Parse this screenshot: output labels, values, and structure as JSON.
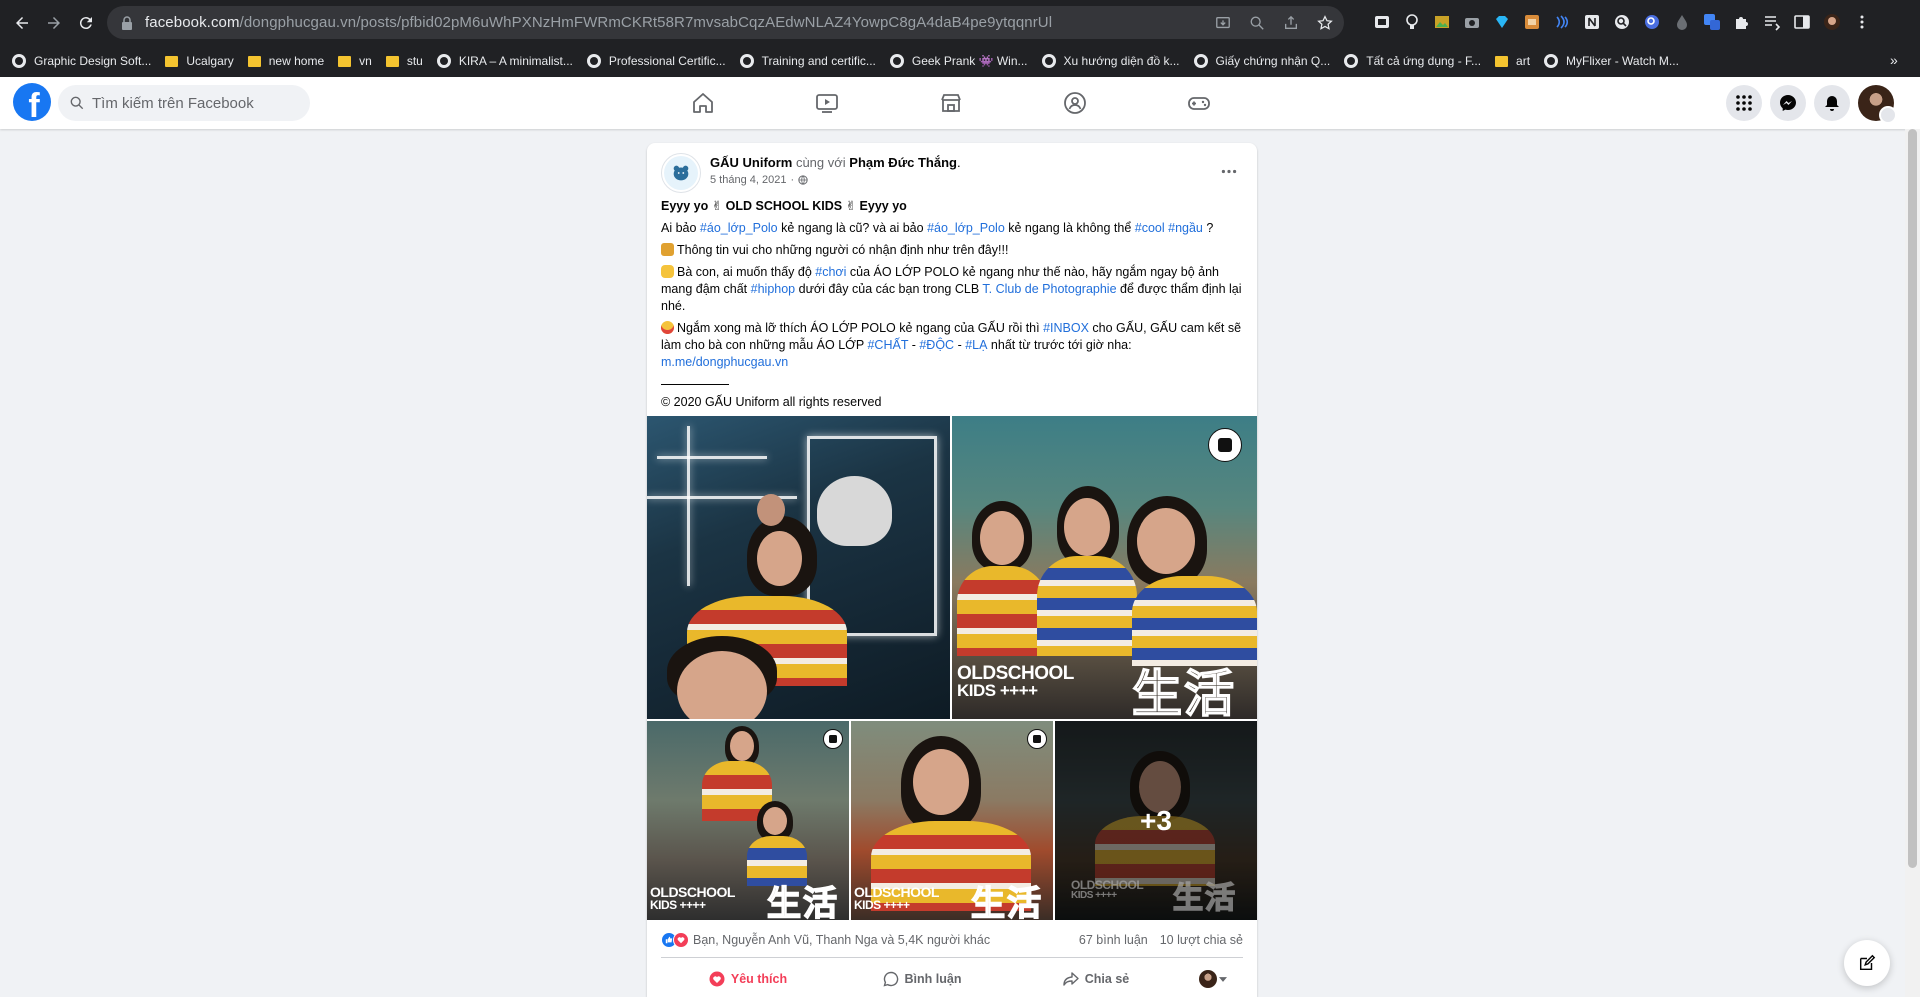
{
  "browser": {
    "url_host": "facebook.com",
    "url_path": "/dongphucgau.vn/posts/pfbid02pM6uWhPXNzHmFWRmCKRt58R7mvsabCqzAEdwNLAZ4YowpC8gA4daB4pe9ytqqnrUl",
    "bookmarks": [
      {
        "label": "Graphic Design Soft...",
        "type": "site"
      },
      {
        "label": "Ucalgary",
        "type": "folder"
      },
      {
        "label": "new home",
        "type": "folder"
      },
      {
        "label": "vn",
        "type": "folder"
      },
      {
        "label": "stu",
        "type": "folder"
      },
      {
        "label": "KIRA – A minimalist...",
        "type": "site"
      },
      {
        "label": "Professional Certific...",
        "type": "site"
      },
      {
        "label": "Training and certific...",
        "type": "site"
      },
      {
        "label": "Geek Prank 👾 Win...",
        "type": "site"
      },
      {
        "label": "Xu hướng diện đồ k...",
        "type": "site"
      },
      {
        "label": "Giấy chứng nhận Q...",
        "type": "site"
      },
      {
        "label": "Tất cả ứng dụng - F...",
        "type": "site"
      },
      {
        "label": "art",
        "type": "folder"
      },
      {
        "label": "MyFlixer - Watch M...",
        "type": "site"
      }
    ],
    "more_bookmarks": "»"
  },
  "facebook": {
    "logo_letter": "f",
    "search_placeholder": "Tìm kiếm trên Facebook",
    "nav_icons": [
      "home-icon",
      "watch-icon",
      "marketplace-icon",
      "groups-icon",
      "gaming-icon"
    ]
  },
  "post": {
    "author": "GẤU Uniform",
    "with_text": " cùng với ",
    "tagged": "Phạm Đức Thắng",
    "tagged_suffix": ".",
    "date": "5 tháng 4, 2021",
    "date_sep": "·",
    "title_line": "Eyyy yo ✌ OLD SCHOOL KIDS ✌ Eyyy yo",
    "p1_a": "Ai bảo ",
    "p1_tag1": "#áo_lớp_Polo",
    "p1_b": " kẻ ngang là cũ? và ai bảo ",
    "p1_tag2": "#áo_lớp_Polo",
    "p1_c": " kẻ ngang là không thể ",
    "p1_tag3": "#cool",
    "p1_d": " ",
    "p1_tag4": "#ngầu",
    "p1_e": " ?",
    "p2": "Thông tin vui cho những người có nhận định như trên đây!!!",
    "p3_a": "Bà con, ai muốn thấy độ ",
    "p3_tag1": "#chơi",
    "p3_b": " của ÁO LỚP POLO kẻ ngang như thế nào, hãy ngắm ngay bộ ảnh mang đậm chất ",
    "p3_tag2": "#hiphop",
    "p3_c": " dưới đây của các bạn trong CLB ",
    "p3_link": "T. Club de Photographie",
    "p3_d": " để được thẩm định lại nhé.",
    "p4_a": "Ngắm xong mà lỡ thích ÁO LỚP POLO kẻ ngang của GẤU rồi thì ",
    "p4_tag1": "#INBOX",
    "p4_b": " cho GẤU, GẤU cam kết sẽ làm cho bà con những mẫu ÁO LỚP ",
    "p4_tag2": "#CHẤT",
    "p4_c": " - ",
    "p4_tag3": "#ĐỘC",
    "p4_d": " - ",
    "p4_tag4": "#LẠ",
    "p4_e": " nhất từ trước tới giờ nha:",
    "p4_link": "m.me/dongphucgau.vn",
    "copyright": "© 2020 GẤU Uniform all rights reserved",
    "photo_brand_line1": "OLDSCHOOL",
    "photo_brand_line2": "KIDS ++++",
    "photo_kanji": "生活",
    "more_photos": "+3",
    "reactions_names": "Bạn, Nguyễn Anh Vũ, Thanh Nga và 5,4K người khác",
    "comments_count": "67 bình luận",
    "shares_count": "10 lượt chia sẻ",
    "action_like": "Yêu thích",
    "action_comment": "Bình luận",
    "action_share": "Chia sẻ"
  },
  "colors": {
    "fb_blue": "#1877f2",
    "hashtag": "#216fdb",
    "love_red": "#f33e58",
    "page_bg": "#f0f2f5"
  }
}
